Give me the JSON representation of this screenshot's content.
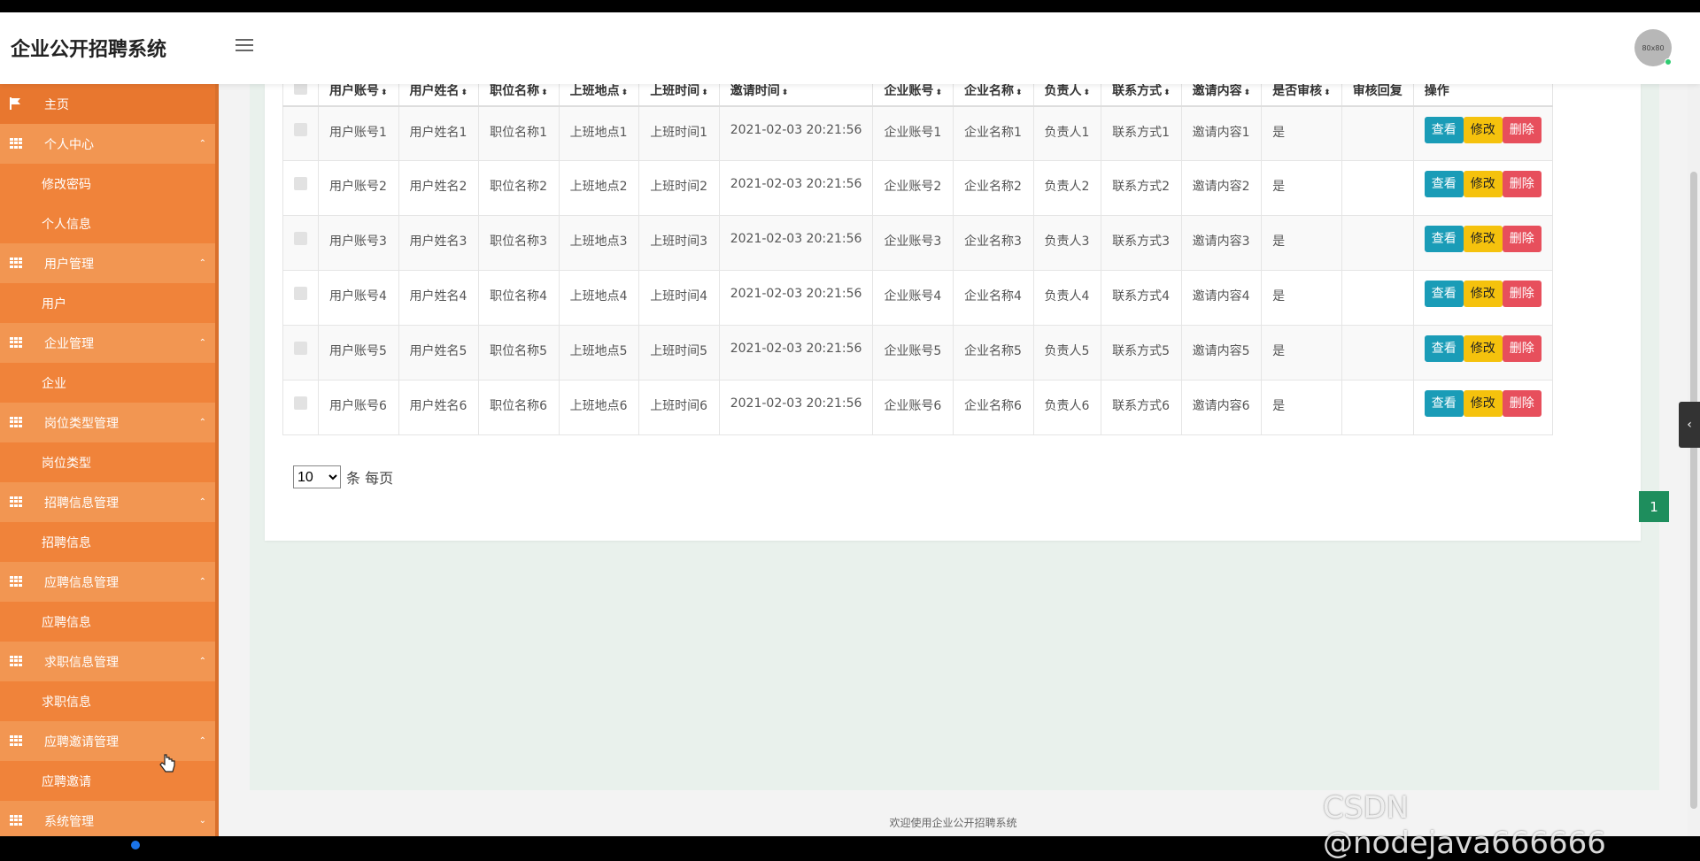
{
  "app": {
    "title": "企业公开招聘系统",
    "avatar_text": "80x80"
  },
  "sidebar": {
    "home": "主页",
    "groups": [
      {
        "label": "个人中心",
        "items": [
          "修改密码",
          "个人信息"
        ]
      },
      {
        "label": "用户管理",
        "items": [
          "用户"
        ]
      },
      {
        "label": "企业管理",
        "items": [
          "企业"
        ]
      },
      {
        "label": "岗位类型管理",
        "items": [
          "岗位类型"
        ]
      },
      {
        "label": "招聘信息管理",
        "items": [
          "招聘信息"
        ]
      },
      {
        "label": "应聘信息管理",
        "items": [
          "应聘信息"
        ]
      },
      {
        "label": "求职信息管理",
        "items": [
          "求职信息"
        ]
      },
      {
        "label": "应聘邀请管理",
        "items": [
          "应聘邀请"
        ]
      },
      {
        "label": "系统管理",
        "items": []
      }
    ]
  },
  "table": {
    "columns": [
      "用户账号",
      "用户姓名",
      "职位名称",
      "上班地点",
      "上班时间",
      "邀请时间",
      "企业账号",
      "企业名称",
      "负责人",
      "联系方式",
      "邀请内容",
      "是否审核",
      "审核回复",
      "操作"
    ],
    "rows": [
      [
        "用户账号1",
        "用户姓名1",
        "职位名称1",
        "上班地点1",
        "上班时间1",
        "2021-02-03 20:21:56",
        "企业账号1",
        "企业名称1",
        "负责人1",
        "联系方式1",
        "邀请内容1",
        "是",
        ""
      ],
      [
        "用户账号2",
        "用户姓名2",
        "职位名称2",
        "上班地点2",
        "上班时间2",
        "2021-02-03 20:21:56",
        "企业账号2",
        "企业名称2",
        "负责人2",
        "联系方式2",
        "邀请内容2",
        "是",
        ""
      ],
      [
        "用户账号3",
        "用户姓名3",
        "职位名称3",
        "上班地点3",
        "上班时间3",
        "2021-02-03 20:21:56",
        "企业账号3",
        "企业名称3",
        "负责人3",
        "联系方式3",
        "邀请内容3",
        "是",
        ""
      ],
      [
        "用户账号4",
        "用户姓名4",
        "职位名称4",
        "上班地点4",
        "上班时间4",
        "2021-02-03 20:21:56",
        "企业账号4",
        "企业名称4",
        "负责人4",
        "联系方式4",
        "邀请内容4",
        "是",
        ""
      ],
      [
        "用户账号5",
        "用户姓名5",
        "职位名称5",
        "上班地点5",
        "上班时间5",
        "2021-02-03 20:21:56",
        "企业账号5",
        "企业名称5",
        "负责人5",
        "联系方式5",
        "邀请内容5",
        "是",
        ""
      ],
      [
        "用户账号6",
        "用户姓名6",
        "职位名称6",
        "上班地点6",
        "上班时间6",
        "2021-02-03 20:21:56",
        "企业账号6",
        "企业名称6",
        "负责人6",
        "联系方式6",
        "邀请内容6",
        "是",
        ""
      ]
    ],
    "actions": {
      "view": "查看",
      "edit": "修改",
      "delete": "删除"
    }
  },
  "pagination": {
    "page_size": "10",
    "page_size_suffix": "条 每页",
    "current_page": "1"
  },
  "footer": "欢迎使用企业公开招聘系统",
  "watermark": "CSDN @nodejava666666",
  "colors": {
    "sidebar": "#f0833a",
    "view": "#1a9cb7",
    "edit": "#f5c20d",
    "delete": "#e74f5c",
    "page": "#1e8e5d"
  }
}
